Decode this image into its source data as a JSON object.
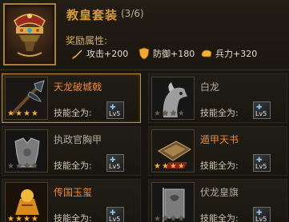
{
  "set": {
    "title": "教皇套装",
    "count": "(3/6)",
    "bonus_label": "奖励属性:",
    "bonuses": [
      {
        "icon": "sword-icon",
        "text": "攻击+200"
      },
      {
        "icon": "shield-icon",
        "text": "防御+180"
      },
      {
        "icon": "fist-icon",
        "text": "兵力+320"
      }
    ]
  },
  "items": [
    {
      "name": "天龙破城戟",
      "owned": true,
      "stars": 4,
      "skill_label": "技能全为:",
      "level": "Lv5",
      "icon": "halberd-icon"
    },
    {
      "name": "白龙",
      "owned": false,
      "stars": 4,
      "skill_label": "技能全为:",
      "level": "Lv5",
      "icon": "horse-icon"
    },
    {
      "name": "执政官胸甲",
      "owned": false,
      "stars": 4,
      "skill_label": "技能全为:",
      "level": "Lv5",
      "icon": "armor-icon"
    },
    {
      "name": "遁甲天书",
      "owned": true,
      "stars": 4,
      "skill_label": "技能全为:",
      "level": "Lv5",
      "icon": "book-icon"
    },
    {
      "name": "传国玉玺",
      "owned": true,
      "stars": 4,
      "skill_label": "技能全为:",
      "level": "Lv5",
      "icon": "seal-icon"
    },
    {
      "name": "伏龙皇旗",
      "owned": false,
      "stars": 4,
      "skill_label": "技能全为:",
      "level": "Lv5",
      "icon": "banner-icon"
    }
  ],
  "colors": {
    "accent": "#d59a3a",
    "owned_name": "#f08a32",
    "star": "#f3b52d"
  }
}
